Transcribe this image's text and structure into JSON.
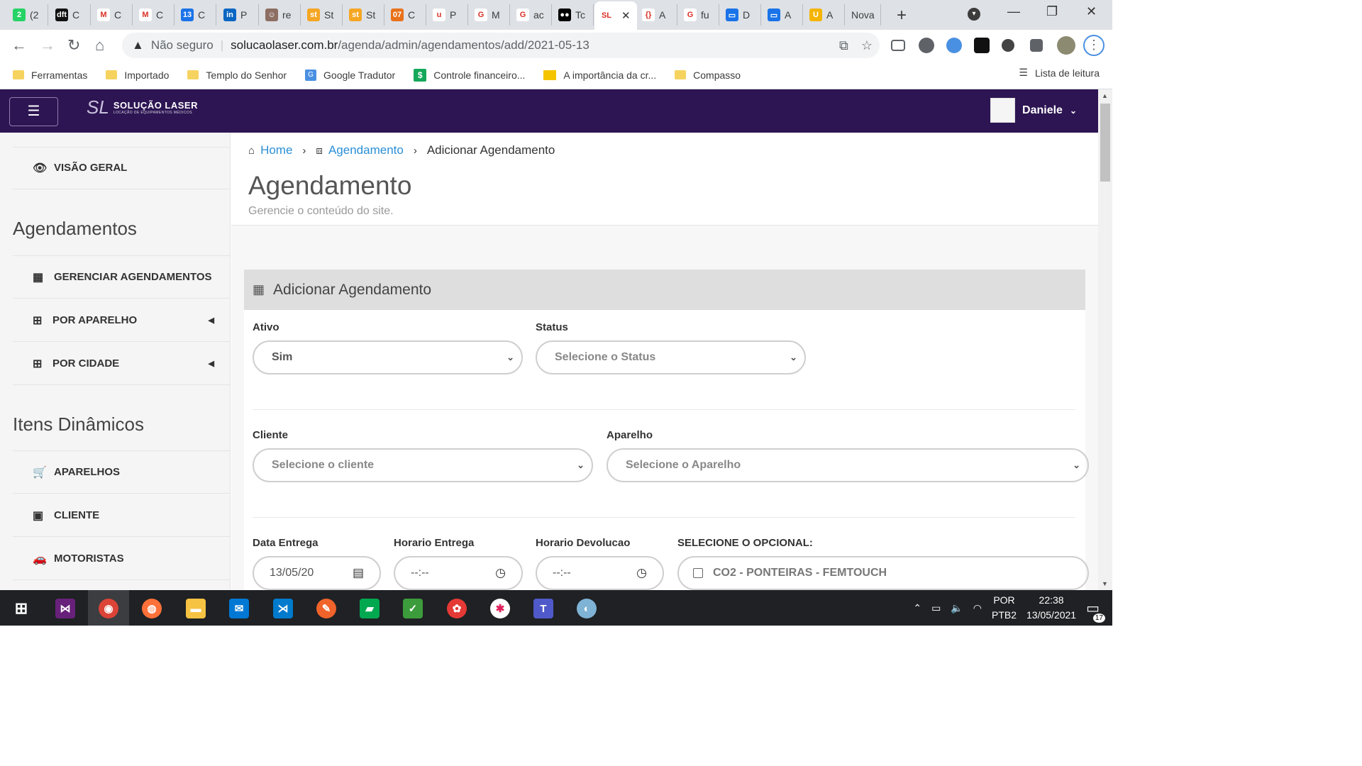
{
  "browser": {
    "tabs": [
      {
        "label": "(2",
        "icon": "whatsapp-icon",
        "color": "#25d366",
        "glyph": "2"
      },
      {
        "label": "C",
        "icon": "dft-icon",
        "color": "#111111",
        "glyph": "dft"
      },
      {
        "label": "C",
        "icon": "gmail-icon",
        "color": "#ffffff",
        "glyph": "M"
      },
      {
        "label": "C",
        "icon": "gmail-icon",
        "color": "#ffffff",
        "glyph": "M"
      },
      {
        "label": "C",
        "icon": "calendar-icon",
        "color": "#1a73e8",
        "glyph": "13"
      },
      {
        "label": "P",
        "icon": "linkedin-icon",
        "color": "#0a66c2",
        "glyph": "in"
      },
      {
        "label": "re",
        "icon": "profile-icon",
        "color": "#8d6e63",
        "glyph": "☺"
      },
      {
        "label": "St",
        "icon": "st-icon",
        "color": "#f5a623",
        "glyph": "st"
      },
      {
        "label": "St",
        "icon": "st-icon",
        "color": "#f5a623",
        "glyph": "st"
      },
      {
        "label": "C",
        "icon": "coin-icon",
        "color": "#e8711a",
        "glyph": "07"
      },
      {
        "label": "P",
        "icon": "pen-icon",
        "color": "#ffffff",
        "glyph": "u"
      },
      {
        "label": "M",
        "icon": "google-icon",
        "color": "#ffffff",
        "glyph": "G"
      },
      {
        "label": "ac",
        "icon": "google-icon",
        "color": "#ffffff",
        "glyph": "G"
      },
      {
        "label": "Tc",
        "icon": "medium-icon",
        "color": "#000000",
        "glyph": "●●"
      },
      {
        "label": "",
        "icon": "solucao-laser-icon",
        "color": "#ffffff",
        "glyph": "SL",
        "active": true
      },
      {
        "label": "A",
        "icon": "code-icon",
        "color": "#ffffff",
        "glyph": "{}"
      },
      {
        "label": "fu",
        "icon": "google-icon",
        "color": "#ffffff",
        "glyph": "G"
      },
      {
        "label": "D",
        "icon": "window-icon",
        "color": "#1a73e8",
        "glyph": "▭"
      },
      {
        "label": "A",
        "icon": "window-icon",
        "color": "#1a73e8",
        "glyph": "▭"
      },
      {
        "label": "A",
        "icon": "shield-icon",
        "color": "#f4b400",
        "glyph": "U"
      },
      {
        "label": "Nova",
        "icon": "",
        "color": "#dee1e6",
        "glyph": ""
      }
    ],
    "address": {
      "security": "Não seguro",
      "host": "solucaolaser.com.br",
      "path": "/agenda/admin/agendamentos/add/2021-05-13"
    },
    "bookmarks": [
      {
        "label": "Ferramentas",
        "type": "folder"
      },
      {
        "label": "Importado",
        "type": "folder"
      },
      {
        "label": "Templo do Senhor",
        "type": "folder"
      },
      {
        "label": "Google Tradutor",
        "type": "gt"
      },
      {
        "label": "Controle financeiro...",
        "type": "cf"
      },
      {
        "label": "A importância da cr...",
        "type": "ai"
      },
      {
        "label": "Compasso",
        "type": "folder"
      }
    ],
    "reading_list": "Lista de leitura"
  },
  "app": {
    "logo_mark": "SL",
    "logo_name": "SOLUÇÃO LASER",
    "logo_sub": "LOCAÇÃO DE EQUIPAMENTOS MÉDICOS",
    "user_name": "Daniele"
  },
  "sidebar": {
    "overview": "VISÃO GERAL",
    "heading_schedules": "Agendamentos",
    "manage": "GERENCIAR AGENDAMENTOS",
    "by_device": "POR APARELHO",
    "by_city": "POR CIDADE",
    "heading_dynamic": "Itens Dinâmicos",
    "devices": "APARELHOS",
    "client": "CLIENTE",
    "drivers": "MOTORISTAS"
  },
  "breadcrumb": {
    "home": "Home",
    "section": "Agendamento",
    "current": "Adicionar Agendamento"
  },
  "page": {
    "title": "Agendamento",
    "subtitle": "Gerencie o conteúdo do site."
  },
  "form": {
    "panel_title": "Adicionar Agendamento",
    "ativo_label": "Ativo",
    "ativo_value": "Sim",
    "status_label": "Status",
    "status_placeholder": "Selecione o Status",
    "cliente_label": "Cliente",
    "cliente_placeholder": "Selecione o cliente",
    "aparelho_label": "Aparelho",
    "aparelho_placeholder": "Selecione o Aparelho",
    "data_entrega_label": "Data Entrega",
    "data_entrega_value": "13/05/20",
    "horario_entrega_label": "Horario Entrega",
    "horario_entrega_value": "--:--",
    "horario_devolucao_label": "Horario Devolucao",
    "horario_devolucao_value": "--:--",
    "opcional_label": "SELECIONE O OPCIONAL:",
    "opcional_item": "CO2 - PONTEIRAS - FEMTOUCH"
  },
  "taskbar": {
    "lang_1": "POR",
    "lang_2": "PTB2",
    "time": "22:38",
    "date": "13/05/2021",
    "notifications": "17"
  }
}
